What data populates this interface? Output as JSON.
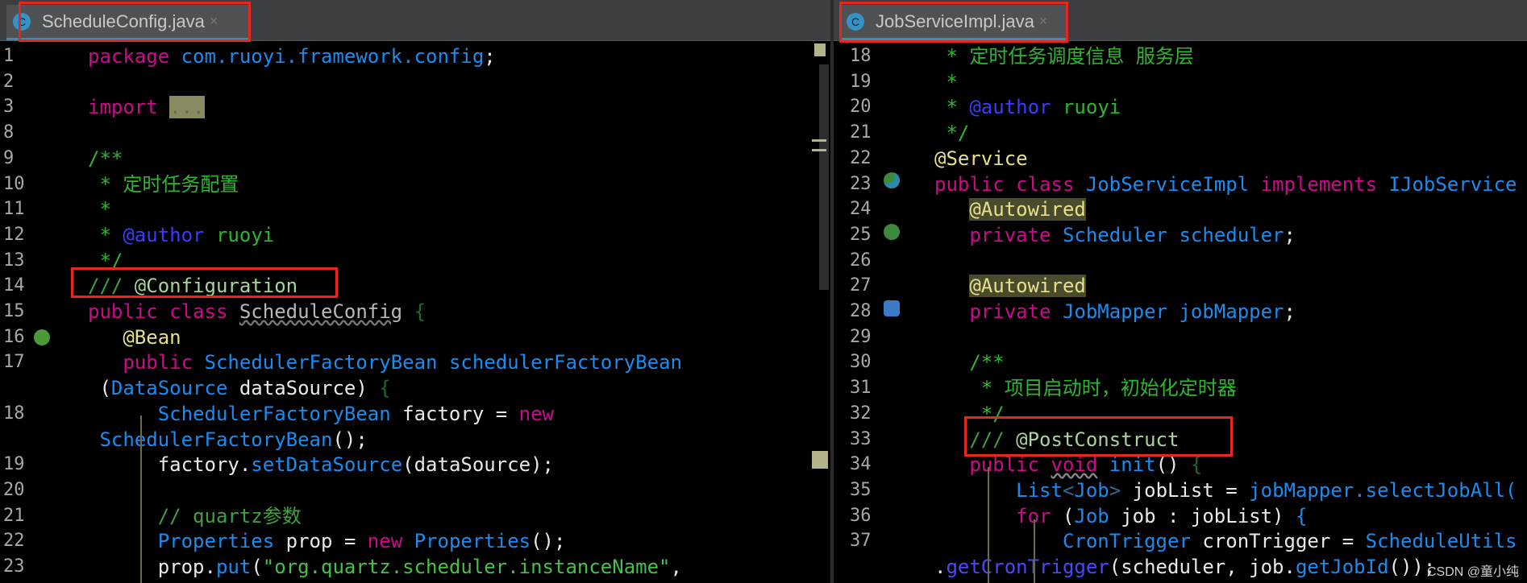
{
  "left": {
    "tab": {
      "label": "ScheduleConfig.java",
      "icon": "C",
      "close": "×"
    },
    "lines": [
      {
        "n": "1",
        "t": [
          [
            "kw",
            "package "
          ],
          [
            "ty",
            "com.ruoyi.framework.config"
          ],
          [
            "id",
            ";"
          ]
        ]
      },
      {
        "n": "2",
        "t": []
      },
      {
        "n": "3",
        "t": [
          [
            "kw",
            "import "
          ],
          [
            "fold",
            "..."
          ]
        ]
      },
      {
        "n": "8",
        "t": []
      },
      {
        "n": "9",
        "t": [
          [
            "cm",
            "/**"
          ]
        ]
      },
      {
        "n": "10",
        "t": [
          [
            "cm",
            " * 定时任务配置"
          ]
        ]
      },
      {
        "n": "11",
        "t": [
          [
            "cm",
            " *"
          ]
        ]
      },
      {
        "n": "12",
        "t": [
          [
            "cm",
            " * "
          ],
          [
            "tag",
            "@author"
          ],
          [
            "cm",
            " ruoyi"
          ]
        ]
      },
      {
        "n": "13",
        "t": [
          [
            "cm",
            " */"
          ]
        ]
      },
      {
        "n": "14",
        "t": [
          [
            "c3",
            "/// "
          ],
          [
            "cfg",
            "@Configuration"
          ]
        ]
      },
      {
        "n": "15",
        "t": [
          [
            "kw",
            "public class "
          ],
          [
            "gr",
            "ScheduleConfig"
          ],
          [
            "br",
            " {"
          ]
        ]
      },
      {
        "n": "16",
        "t": [
          [
            "id",
            "   "
          ],
          [
            "an",
            "@Bean"
          ]
        ]
      },
      {
        "n": "17",
        "t": [
          [
            "id",
            "   "
          ],
          [
            "kw",
            "public "
          ],
          [
            "ty",
            "SchedulerFactoryBean "
          ],
          [
            "fn",
            "schedulerFactoryBean"
          ]
        ]
      },
      {
        "n": "",
        "t": [
          [
            "id",
            " ("
          ],
          [
            "ty",
            "DataSource"
          ],
          [
            "id",
            " dataSource) "
          ],
          [
            "br",
            "{"
          ]
        ]
      },
      {
        "n": "18",
        "t": [
          [
            "id",
            "      "
          ],
          [
            "ty",
            "SchedulerFactoryBean"
          ],
          [
            "id",
            " factory = "
          ],
          [
            "kw",
            "new"
          ]
        ]
      },
      {
        "n": "",
        "t": [
          [
            "ty",
            " SchedulerFactoryBean"
          ],
          [
            "id",
            "();"
          ]
        ]
      },
      {
        "n": "19",
        "t": [
          [
            "id",
            "      factory."
          ],
          [
            "fn",
            "setDataSource"
          ],
          [
            "id",
            "(dataSource);"
          ]
        ]
      },
      {
        "n": "20",
        "t": []
      },
      {
        "n": "21",
        "t": [
          [
            "c3",
            "      // quartz参数"
          ]
        ]
      },
      {
        "n": "22",
        "t": [
          [
            "id",
            "      "
          ],
          [
            "ty",
            "Properties"
          ],
          [
            "id",
            " prop = "
          ],
          [
            "kw",
            "new "
          ],
          [
            "ty",
            "Properties"
          ],
          [
            "id",
            "();"
          ]
        ]
      },
      {
        "n": "23",
        "t": [
          [
            "id",
            "      prop."
          ],
          [
            "fn",
            "put"
          ],
          [
            "id",
            "("
          ],
          [
            "str",
            "\"org.quartz.scheduler.instanceName\""
          ],
          [
            "id",
            ","
          ]
        ]
      }
    ]
  },
  "right": {
    "tab": {
      "label": "JobServiceImpl.java",
      "icon": "C",
      "close": "×"
    },
    "lines": [
      {
        "n": "18",
        "t": [
          [
            "cm",
            " * 定时任务调度信息 服务层"
          ]
        ]
      },
      {
        "n": "19",
        "t": [
          [
            "cm",
            " *"
          ]
        ]
      },
      {
        "n": "20",
        "t": [
          [
            "cm",
            " * "
          ],
          [
            "tag",
            "@author"
          ],
          [
            "cm",
            " ruoyi"
          ]
        ]
      },
      {
        "n": "21",
        "t": [
          [
            "cm",
            " */"
          ]
        ]
      },
      {
        "n": "22",
        "t": [
          [
            "an",
            "@Service"
          ]
        ]
      },
      {
        "n": "23",
        "t": [
          [
            "kw",
            "public class "
          ],
          [
            "ty",
            "JobServiceImpl "
          ],
          [
            "kw",
            "implements "
          ],
          [
            "ty",
            "IJobService"
          ]
        ]
      },
      {
        "n": "24",
        "t": [
          [
            "id",
            "   "
          ],
          [
            "anbg",
            "@Autowired"
          ]
        ]
      },
      {
        "n": "25",
        "t": [
          [
            "id",
            "   "
          ],
          [
            "kw",
            "private "
          ],
          [
            "ty",
            "Scheduler scheduler"
          ],
          [
            "id",
            ";"
          ]
        ]
      },
      {
        "n": "26",
        "t": []
      },
      {
        "n": "27",
        "t": [
          [
            "id",
            "   "
          ],
          [
            "anbg",
            "@Autowired"
          ]
        ]
      },
      {
        "n": "28",
        "t": [
          [
            "id",
            "   "
          ],
          [
            "kw",
            "private "
          ],
          [
            "ty",
            "JobMapper jobMapper"
          ],
          [
            "id",
            ";"
          ]
        ]
      },
      {
        "n": "29",
        "t": []
      },
      {
        "n": "30",
        "t": [
          [
            "cm",
            "   /**"
          ]
        ]
      },
      {
        "n": "31",
        "t": [
          [
            "cm",
            "    * 项目启动时，初始化定时器"
          ]
        ]
      },
      {
        "n": "32",
        "t": [
          [
            "cm",
            "    */"
          ]
        ]
      },
      {
        "n": "33",
        "t": [
          [
            "c3",
            "   /// "
          ],
          [
            "cfg",
            "@PostConstruct"
          ]
        ]
      },
      {
        "n": "34",
        "t": [
          [
            "id",
            "   "
          ],
          [
            "kw",
            "public "
          ],
          [
            "kw wav",
            "void"
          ],
          [
            "id",
            " "
          ],
          [
            "fn",
            "init"
          ],
          [
            "id",
            "() "
          ],
          [
            "br",
            "{"
          ]
        ]
      },
      {
        "n": "35",
        "t": [
          [
            "id",
            "       "
          ],
          [
            "ty",
            "List"
          ],
          [
            "ang",
            "<"
          ],
          [
            "ty",
            "Job"
          ],
          [
            "ang",
            ">"
          ],
          [
            "id",
            " jobList = "
          ],
          [
            "fn",
            "jobMapper.selectJobAll("
          ]
        ]
      },
      {
        "n": "36",
        "t": [
          [
            "id",
            "       "
          ],
          [
            "kw",
            "for "
          ],
          [
            "id",
            "("
          ],
          [
            "ty",
            "Job"
          ],
          [
            "id",
            " job : jobList) "
          ],
          [
            "ty",
            "{"
          ]
        ]
      },
      {
        "n": "37",
        "t": [
          [
            "id",
            "           "
          ],
          [
            "ty",
            "CronTrigger"
          ],
          [
            "id",
            " cronTrigger = "
          ],
          [
            "ty",
            "ScheduleUtils"
          ]
        ]
      },
      {
        "n": "",
        "t": [
          [
            "id",
            "."
          ],
          [
            "fn2",
            "getCronTrigger"
          ],
          [
            "id",
            "(scheduler, job."
          ],
          [
            "fn",
            "getJobId"
          ],
          [
            "id",
            "());"
          ]
        ]
      }
    ]
  },
  "watermark": "CSDN @童小纯"
}
